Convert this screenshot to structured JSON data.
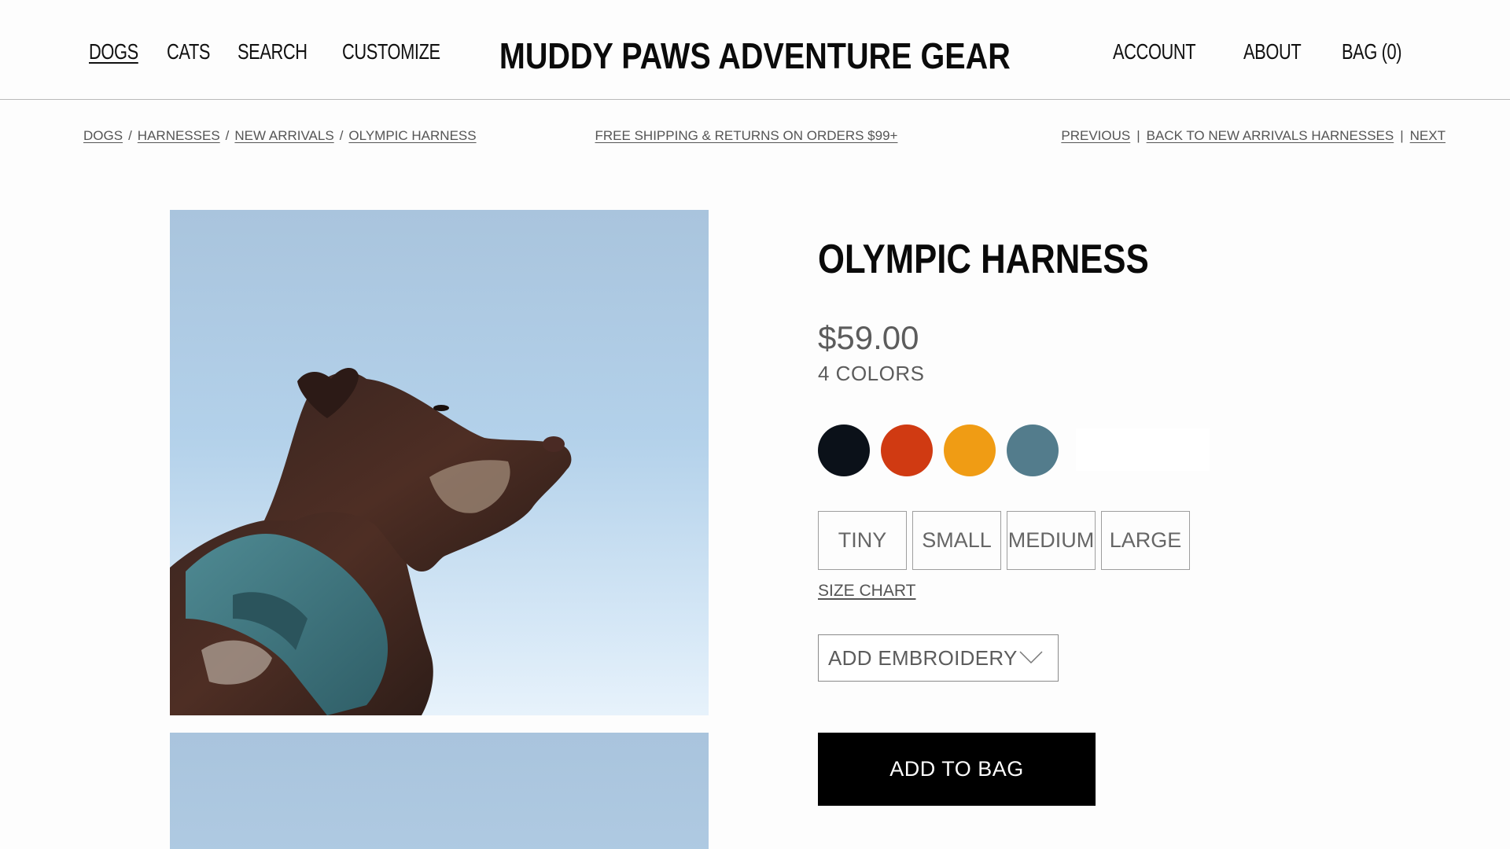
{
  "header": {
    "brand": "MUDDY PAWS ADVENTURE GEAR",
    "nav_left": [
      "DOGS",
      "CATS",
      "SEARCH",
      "CUSTOMIZE"
    ],
    "nav_right": [
      "ACCOUNT",
      "ABOUT",
      "BAG (0)"
    ],
    "active_nav": "DOGS"
  },
  "breadcrumb": [
    "DOGS",
    "HARNESSES",
    "NEW ARRIVALS",
    "OLYMPIC HARNESS"
  ],
  "promo": "FREE SHIPPING & RETURNS ON ORDERS $99+",
  "pager": {
    "previous": "PREVIOUS",
    "back": "BACK TO NEW ARRIVALS HARNESSES",
    "next": "NEXT",
    "separator": "|"
  },
  "product": {
    "title": "OLYMPIC HARNESS",
    "price": "$59.00",
    "colors_label": "4 COLORS",
    "swatches": [
      {
        "name": "black",
        "color": "#0b1119"
      },
      {
        "name": "red",
        "color": "#d03a12"
      },
      {
        "name": "orange",
        "color": "#f09c14"
      },
      {
        "name": "slate-blue",
        "color": "#537c8c"
      }
    ],
    "sizes": [
      "TINY",
      "SMALL",
      "MEDIUM",
      "LARGE"
    ],
    "size_chart": "SIZE CHART",
    "embroidery": "ADD EMBROIDERY",
    "add_to_bag": "ADD TO BAG",
    "image_alt": "Brown dog wearing a teal harness against blue sky"
  }
}
